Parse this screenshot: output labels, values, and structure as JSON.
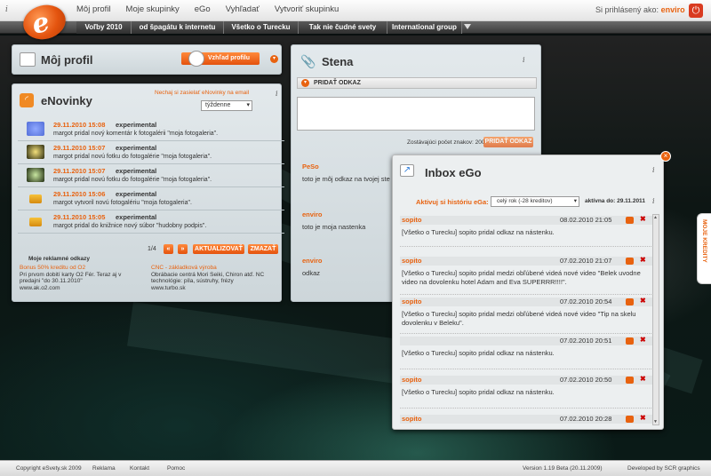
{
  "topbar": {
    "info": "i",
    "nav": [
      "Môj profil",
      "Moje skupinky",
      "eGo",
      "Vyhľadať",
      "Vytvoriť skupinku"
    ],
    "login_prefix": "Si prihlásený ako:",
    "login_user": "enviro"
  },
  "subnav": [
    "Voľby 2010",
    "od špagátu k internetu",
    "Všetko o Turecku",
    "Tak nie čudné svety",
    "International group"
  ],
  "profile": {
    "title": "Môj profil",
    "search_btn": "Vzhľad profilu"
  },
  "news": {
    "title": "eNovinky",
    "email_link": "Nechaj si zasielať eNovinky na email",
    "freq": "týždenne",
    "items": [
      {
        "time": "29.11.2010 15:08",
        "user": "experimental",
        "msg": "margot pridal nový komentár k fotogalérii \"moja fotogaleria\"."
      },
      {
        "time": "29.11.2010 15:07",
        "user": "experimental",
        "msg": "margot pridal novú fotku do fotogalérie \"moja fotogaleria\"."
      },
      {
        "time": "29.11.2010 15:07",
        "user": "experimental",
        "msg": "margot pridal novú fotku do fotogalérie \"moja fotogaleria\"."
      },
      {
        "time": "29.11.2010 15:06",
        "user": "experimental",
        "msg": "margot vytvoril novú fotogalériu \"moja fotogaleria\"."
      },
      {
        "time": "29.11.2010 15:05",
        "user": "experimental",
        "msg": "margot pridal do knižnice nový súbor \"hudobny podpis\"."
      }
    ],
    "page": "1/4",
    "update_btn": "AKTUALIZOVAŤ",
    "delete_btn": "ZMAZAŤ",
    "ads_title": "Moje reklamné odkazy",
    "ad1_title": "Bonus 50% kreditu od O2",
    "ad1_text": "Pri prvom dobití karty O2 Fér. Teraz aj v predajni \"do 30.11.2010\"",
    "ad1_url": "www.ak.o2.com",
    "ad2_title": "CNC - základková výroba",
    "ad2_text": "Obrábacie centrá Mori Seiki, Chiron atď. NC technológie: píla, sústruhy, frézy",
    "ad2_url": "www.turbo.sk"
  },
  "wall": {
    "title": "Stena",
    "add_label": "PRIDAŤ ODKAZ",
    "chars_label": "Zostávajúci počet znakov: 200",
    "add_btn": "PRIDAŤ ODKAZ",
    "posts": [
      {
        "user": "PeSo",
        "text": "toto je môj odkaz na tvojej ste"
      },
      {
        "user": "enviro",
        "text": "toto je moja nastenka"
      },
      {
        "user": "enviro",
        "text": "odkaz"
      }
    ]
  },
  "inbox": {
    "title": "Inbox eGo",
    "activate_label": "Aktivuj si históriu eGa:",
    "activate_value": "celý rok (-28 kreditov)",
    "active_to": "aktívna do: 29.11.2011",
    "messages": [
      {
        "user": "sopito",
        "date": "08.02.2010 21:05",
        "text": "[Všetko o Turecku] sopito pridal odkaz na nástenku."
      },
      {
        "user": "sopito",
        "date": "07.02.2010 21:07",
        "text": "[Všetko o Turecku] sopito pridal medzi obľúbené videá nové video \"Belek uvodne video na dovolenku hotel Adam and Eva SUPERRR!!!!\"."
      },
      {
        "user": "sopito",
        "date": "07.02.2010 20:54",
        "text": "[Všetko o Turecku] sopito pridal medzi obľúbené videá nové video \"Tip na skelu dovolenku v Beleku\"."
      },
      {
        "user": "",
        "date": "07.02.2010 20:51",
        "text": "[Všetko o Turecku] sopito pridal odkaz na nástenku."
      },
      {
        "user": "sopito",
        "date": "07.02.2010 20:50",
        "text": "[Všetko o Turecku] sopito pridal odkaz na nástenku."
      },
      {
        "user": "sopito",
        "date": "07.02.2010 20:28",
        "text": ""
      }
    ]
  },
  "side_tab": "MOJE KREDITY",
  "footer": {
    "copyright": "Copyright eSvety.sk 2009",
    "reklama": "Reklama",
    "kontakt": "Kontakt",
    "pomoc": "Pomoc",
    "version": "Version 1.19 Beta (20.11.2009)",
    "dev": "Developed by SCR graphics"
  }
}
